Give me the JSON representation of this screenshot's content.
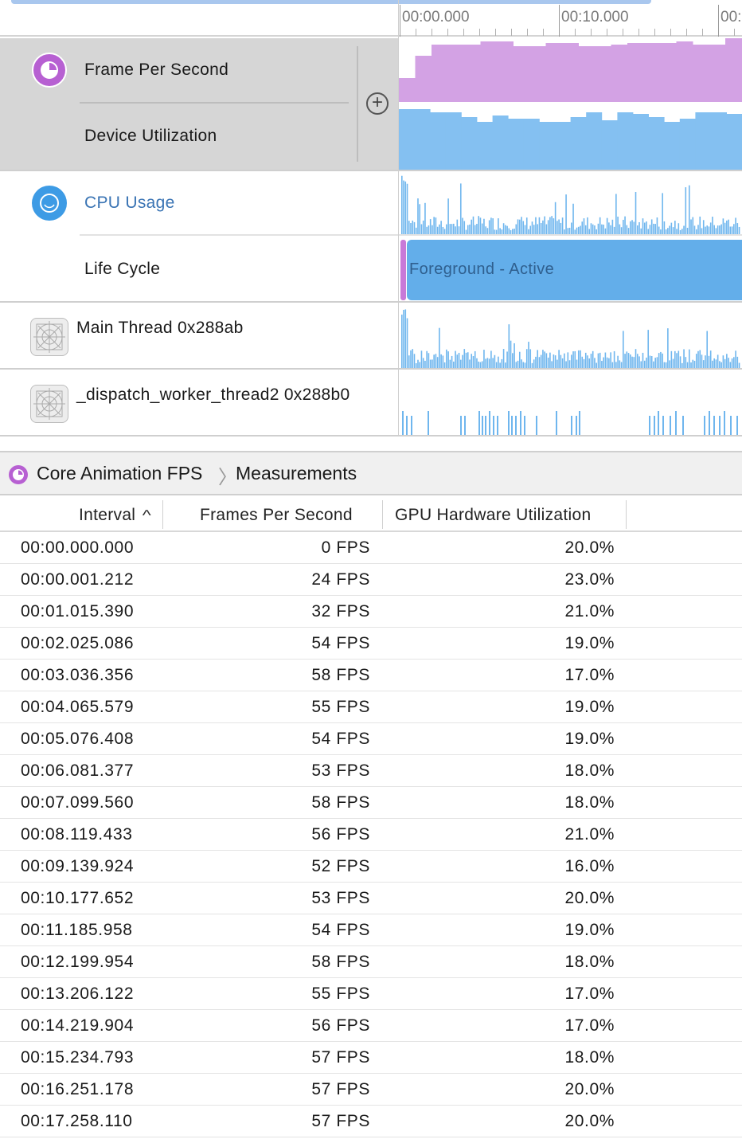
{
  "timeline": {
    "ruler_labels": [
      "00:00.000",
      "00:10.000",
      "00:"
    ]
  },
  "tracks": {
    "core_animation": {
      "icon": "core-animation-clock-icon",
      "fps_label": "Frame Per Second",
      "util_label": "Device Utilization",
      "add_icon": "plus-circle-icon"
    },
    "activity": {
      "icon": "cpu-gauge-icon",
      "cpu_label": "CPU Usage",
      "lifecycle_label": "Life Cycle",
      "lifecycle_state": "Foreground - Active"
    },
    "main_thread": {
      "icon": "thread-grid-icon",
      "label": "Main Thread  0x288ab"
    },
    "worker_thread": {
      "icon": "thread-grid-icon",
      "label": "_dispatch_worker_thread2  0x288b0"
    }
  },
  "colors": {
    "fps_fill": "#d3a2e4",
    "util_fill": "#84c0f1",
    "cpu_fill": "#6fb6ee",
    "lifecycle_active": "#63aeea",
    "lifecycle_launch": "#c879d8",
    "selection_bg": "#d6d6d6",
    "core_animation_icon": "#b760d2"
  },
  "detail": {
    "instrument_label": "Core Animation FPS",
    "breadcrumb_sep": "〉",
    "view_label": "Measurements"
  },
  "table": {
    "columns": {
      "interval": "Interval",
      "sort_indicator": "^",
      "fps": "Frames Per Second",
      "gpu": "GPU Hardware Utilization"
    },
    "rows": [
      {
        "interval": "00:00.000.000",
        "fps": "0 FPS",
        "gpu": "20.0%"
      },
      {
        "interval": "00:00.001.212",
        "fps": "24 FPS",
        "gpu": "23.0%"
      },
      {
        "interval": "00:01.015.390",
        "fps": "32 FPS",
        "gpu": "21.0%"
      },
      {
        "interval": "00:02.025.086",
        "fps": "54 FPS",
        "gpu": "19.0%"
      },
      {
        "interval": "00:03.036.356",
        "fps": "58 FPS",
        "gpu": "17.0%"
      },
      {
        "interval": "00:04.065.579",
        "fps": "55 FPS",
        "gpu": "19.0%"
      },
      {
        "interval": "00:05.076.408",
        "fps": "54 FPS",
        "gpu": "19.0%"
      },
      {
        "interval": "00:06.081.377",
        "fps": "53 FPS",
        "gpu": "18.0%"
      },
      {
        "interval": "00:07.099.560",
        "fps": "58 FPS",
        "gpu": "18.0%"
      },
      {
        "interval": "00:08.119.433",
        "fps": "56 FPS",
        "gpu": "21.0%"
      },
      {
        "interval": "00:09.139.924",
        "fps": "52 FPS",
        "gpu": "16.0%"
      },
      {
        "interval": "00:10.177.652",
        "fps": "53 FPS",
        "gpu": "20.0%"
      },
      {
        "interval": "00:11.185.958",
        "fps": "54 FPS",
        "gpu": "19.0%"
      },
      {
        "interval": "00:12.199.954",
        "fps": "58 FPS",
        "gpu": "18.0%"
      },
      {
        "interval": "00:13.206.122",
        "fps": "55 FPS",
        "gpu": "17.0%"
      },
      {
        "interval": "00:14.219.904",
        "fps": "56 FPS",
        "gpu": "17.0%"
      },
      {
        "interval": "00:15.234.793",
        "fps": "57 FPS",
        "gpu": "18.0%"
      },
      {
        "interval": "00:16.251.178",
        "fps": "57 FPS",
        "gpu": "20.0%"
      },
      {
        "interval": "00:17.258.110",
        "fps": "57 FPS",
        "gpu": "20.0%"
      }
    ]
  }
}
